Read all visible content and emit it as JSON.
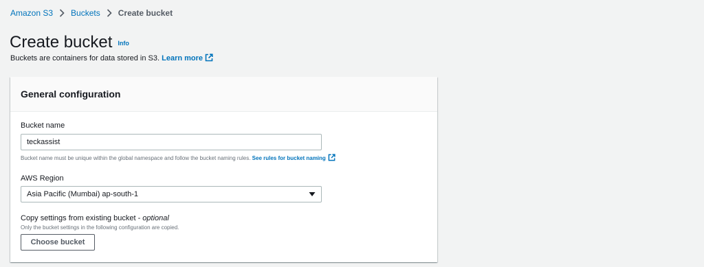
{
  "breadcrumb": {
    "items": [
      "Amazon S3",
      "Buckets"
    ],
    "current": "Create bucket"
  },
  "header": {
    "title": "Create bucket",
    "info": "Info",
    "description": "Buckets are containers for data stored in S3.",
    "learn_more": "Learn more"
  },
  "general_config": {
    "title": "General configuration",
    "bucket_name": {
      "label": "Bucket name",
      "value": "teckassist",
      "hint": "Bucket name must be unique within the global namespace and follow the bucket naming rules.",
      "hint_link": "See rules for bucket naming"
    },
    "region": {
      "label": "AWS Region",
      "selected": "Asia Pacific (Mumbai) ap-south-1"
    },
    "copy_settings": {
      "label": "Copy settings from existing bucket - ",
      "label_optional": "optional",
      "hint": "Only the bucket settings in the following configuration are copied.",
      "button": "Choose bucket"
    }
  },
  "colors": {
    "link": "#0073bb",
    "background": "#f2f3f3",
    "text": "#16191f"
  },
  "icons": [
    "chevron-right-icon",
    "external-link-icon",
    "caret-down-icon"
  ]
}
